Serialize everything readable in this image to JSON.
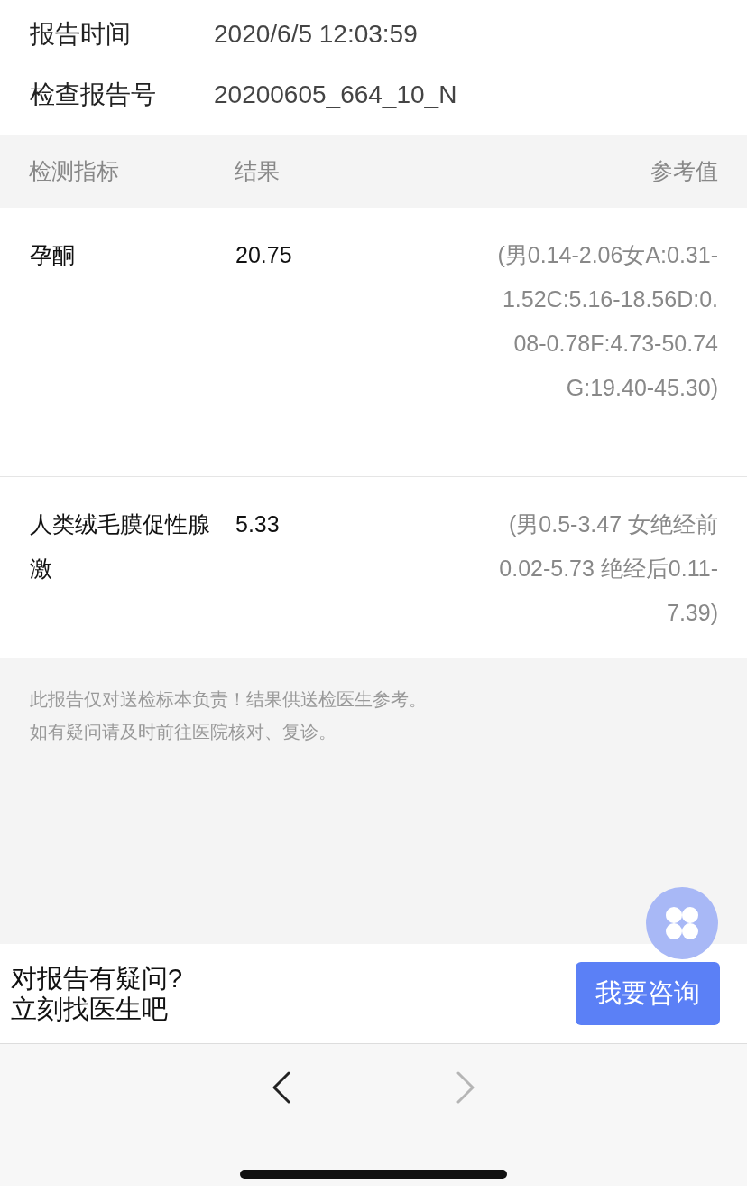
{
  "info": [
    {
      "label": "报告时间",
      "value": "2020/6/5 12:03:59"
    },
    {
      "label": "检查报告号",
      "value": "20200605_664_10_N"
    }
  ],
  "table": {
    "columns": [
      "检测指标",
      "结果",
      "参考值"
    ],
    "rows": [
      {
        "name": "孕酮",
        "result": "20.75",
        "reference": "(男0.14-2.06女A:0.31-1.52C:5.16-18.56D:0.08-0.78F:4.73-50.74G:19.40-45.30)"
      },
      {
        "name": "人类绒毛膜促性腺激",
        "result": "5.33",
        "reference": "(男0.5-3.47 女绝经前0.02-5.73 绝经后0.11-7.39)"
      }
    ]
  },
  "notes": [
    "此报告仅对送检标本负责！结果供送检医生参考。",
    "如有疑问请及时前往医院核对、复诊。"
  ],
  "consult": {
    "lines": [
      "对报告有疑问?",
      "立刻找医生吧"
    ],
    "button": "我要咨询"
  },
  "nav": [
    {
      "kind": "back",
      "disabled": false
    },
    {
      "kind": "forward",
      "disabled": true
    }
  ]
}
